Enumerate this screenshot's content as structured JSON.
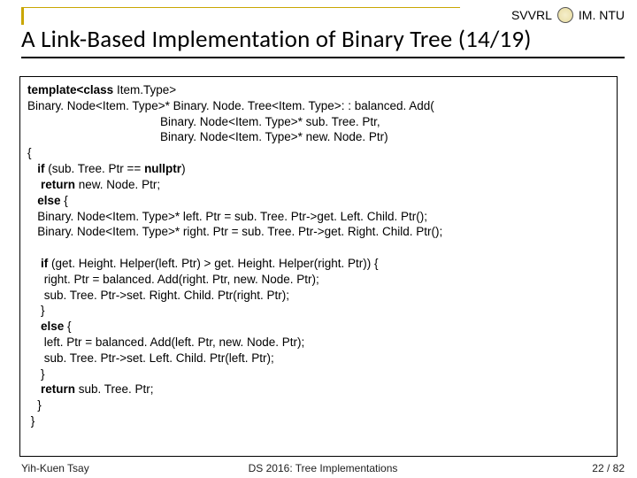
{
  "header": {
    "left_label": "SVVRL",
    "logo_text": "",
    "right_label": "IM. NTU"
  },
  "title": "A Link-Based Implementation of Binary Tree (14/19)",
  "code": {
    "l01a": "template<class ",
    "l01b": "Item.Type>",
    "l02": "Binary. Node<Item. Type>* Binary. Node. Tree<Item. Type>: : balanced. Add(",
    "l03": "                                        Binary. Node<Item. Type>* sub. Tree. Ptr,",
    "l04": "                                        Binary. Node<Item. Type>* new. Node. Ptr)",
    "l05": "{",
    "l06a": "   if ",
    "l06b": "(sub. Tree. Ptr == ",
    "l06c": "nullptr",
    "l06d": ")",
    "l07a": "    return ",
    "l07b": "new. Node. Ptr;",
    "l08a": "   else ",
    "l08b": "{",
    "l09": "   Binary. Node<Item. Type>* left. Ptr = sub. Tree. Ptr->get. Left. Child. Ptr();",
    "l10": "   Binary. Node<Item. Type>* right. Ptr = sub. Tree. Ptr->get. Right. Child. Ptr();",
    "blank1": " ",
    "l11a": "    if ",
    "l11b": "(get. Height. Helper(left. Ptr) > get. Height. Helper(right. Ptr)) {",
    "l12": "     right. Ptr = balanced. Add(right. Ptr, new. Node. Ptr);",
    "l13": "     sub. Tree. Ptr->set. Right. Child. Ptr(right. Ptr);",
    "l14": "    }",
    "l15a": "    else ",
    "l15b": "{",
    "l16": "     left. Ptr = balanced. Add(left. Ptr, new. Node. Ptr);",
    "l17": "     sub. Tree. Ptr->set. Left. Child. Ptr(left. Ptr);",
    "l18": "    }",
    "l19a": "    return ",
    "l19b": "sub. Tree. Ptr;",
    "l20": "   }",
    "l21": " }"
  },
  "footer": {
    "left": "Yih-Kuen Tsay",
    "center": "DS 2016: Tree Implementations",
    "right": "22 / 82"
  }
}
